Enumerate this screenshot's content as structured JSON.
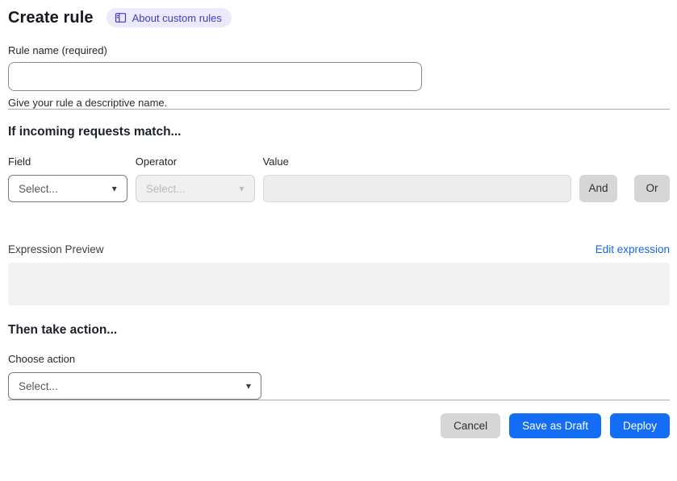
{
  "page": {
    "title": "Create rule",
    "about_link": "About custom rules"
  },
  "rule_name": {
    "label": "Rule name (required)",
    "value": "",
    "helper": "Give your rule a descriptive name."
  },
  "match_section": {
    "heading": "If incoming requests match...",
    "field": {
      "label": "Field",
      "value": "Select..."
    },
    "operator": {
      "label": "Operator",
      "value": "Select...",
      "disabled": "true"
    },
    "value": {
      "label": "Value",
      "value": "",
      "disabled": "true"
    },
    "and_label": "And",
    "or_label": "Or"
  },
  "expression": {
    "label": "Expression Preview",
    "edit_link": "Edit expression",
    "preview": ""
  },
  "action_section": {
    "heading": "Then take action...",
    "choose_label": "Choose action",
    "value": "Select..."
  },
  "footer": {
    "cancel": "Cancel",
    "save_draft": "Save as Draft",
    "deploy": "Deploy"
  },
  "glyphs": {
    "caret_down": "▾"
  },
  "icons": {
    "about_badge": "book-icon",
    "selects": "caret-down-icon"
  },
  "colors": {
    "primary_blue": "#146ef5",
    "link_blue": "#1667d9",
    "badge_bg": "#eceafa",
    "badge_text": "#3e3cc3",
    "disabled_bg": "#f0f0f0",
    "neutral_button_bg": "#d6d6d6",
    "divider": "#a9a9a9"
  }
}
